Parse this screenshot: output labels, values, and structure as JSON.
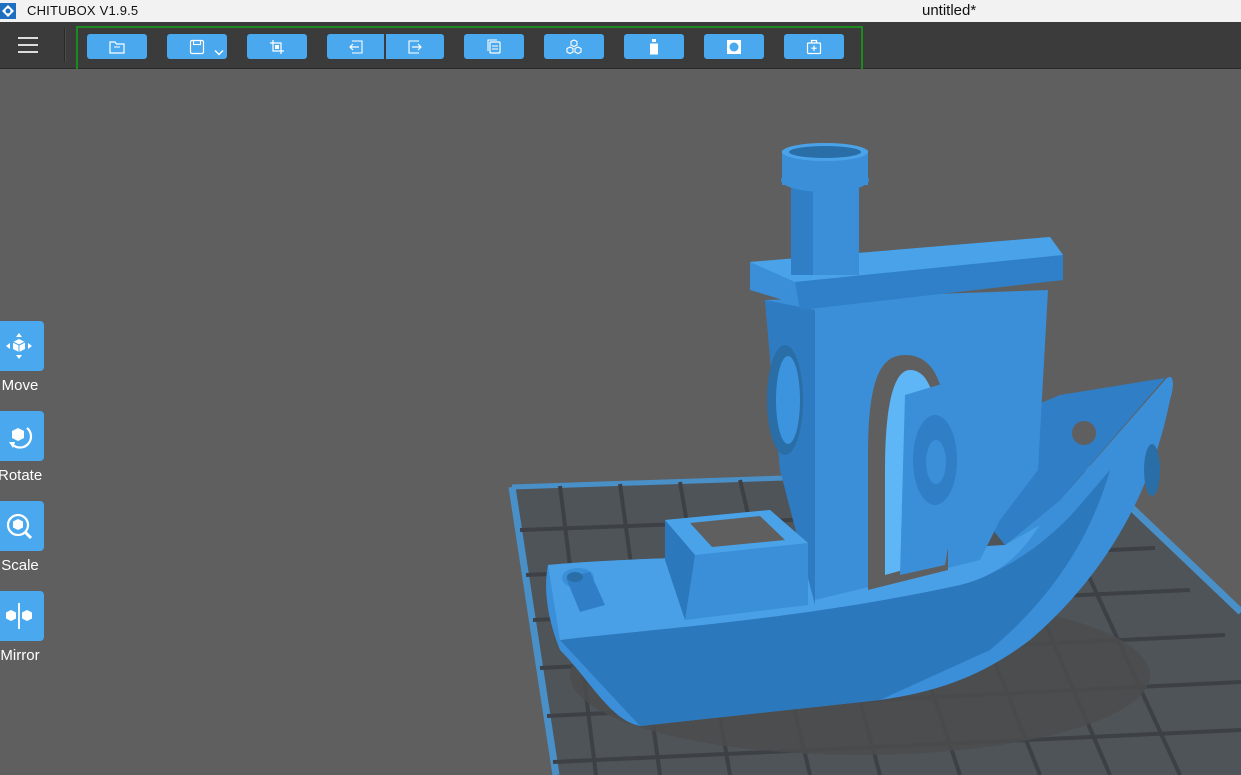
{
  "titlebar": {
    "app_name": "CHITUBOX V1.9.5",
    "document_title": "untitled*"
  },
  "toolbar": {
    "menu_icon": "hamburger-menu-icon",
    "buttons": [
      {
        "name": "open-file-button",
        "icon": "folder-icon"
      },
      {
        "name": "save-file-button",
        "icon": "save-disk-icon",
        "has_dropdown": true
      },
      {
        "name": "select-button",
        "icon": "crop-select-icon"
      },
      {
        "name": "undo-button",
        "icon": "undo-arrow-icon"
      },
      {
        "name": "redo-button",
        "icon": "redo-arrow-icon"
      },
      {
        "name": "copy-button",
        "icon": "copy-layers-icon"
      },
      {
        "name": "arrange-button",
        "icon": "cubes-arrange-icon"
      },
      {
        "name": "resin-button",
        "icon": "resin-bottle-icon"
      },
      {
        "name": "hollow-button",
        "icon": "hollow-square-icon"
      },
      {
        "name": "support-button",
        "icon": "support-kit-icon"
      }
    ]
  },
  "tools": [
    {
      "label": "Move",
      "icon": "move-icon"
    },
    {
      "label": "Rotate",
      "icon": "rotate-icon"
    },
    {
      "label": "Scale",
      "icon": "scale-icon"
    },
    {
      "label": "Mirror",
      "icon": "mirror-icon"
    }
  ],
  "scene": {
    "model": "benchy-boat",
    "model_color": "#3a8fd8",
    "platform_color": "#4a90c8"
  }
}
